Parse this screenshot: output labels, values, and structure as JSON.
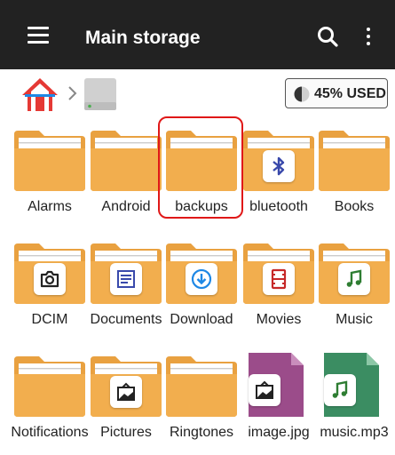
{
  "appbar": {
    "title": "Main storage",
    "icons": [
      "menu-icon",
      "search-icon",
      "more-vertical-icon"
    ]
  },
  "breadcrumb": {
    "icons": [
      "home-icon",
      "chevron-right-icon",
      "drive-icon"
    ],
    "usage_label": "45% USED",
    "usage_fraction": 0.45
  },
  "colors": {
    "appbar_bg": "#222222",
    "folder": "#F2AE4E",
    "folder_tab": "#E9A140",
    "selection": "#e01818",
    "image_file": "#9B4C8A",
    "audio_file": "#3B8D62"
  },
  "items": [
    {
      "label": "Alarms",
      "type": "folder"
    },
    {
      "label": "Android",
      "type": "folder"
    },
    {
      "label": "backups",
      "type": "folder",
      "selected": true
    },
    {
      "label": "bluetooth",
      "type": "folder",
      "badge": "bluetooth-icon"
    },
    {
      "label": "Books",
      "type": "folder"
    },
    {
      "label": "DCIM",
      "type": "folder",
      "badge": "camera-icon"
    },
    {
      "label": "Documents",
      "type": "folder",
      "badge": "document-icon"
    },
    {
      "label": "Download",
      "type": "folder",
      "badge": "download-icon"
    },
    {
      "label": "Movies",
      "type": "folder",
      "badge": "film-icon"
    },
    {
      "label": "Music",
      "type": "folder",
      "badge": "music-note-icon"
    },
    {
      "label": "Notifications",
      "type": "folder"
    },
    {
      "label": "Pictures",
      "type": "folder",
      "badge": "image-icon"
    },
    {
      "label": "Ringtones",
      "type": "folder"
    },
    {
      "label": "image.jpg",
      "type": "file",
      "badge": "image-icon"
    },
    {
      "label": "music.mp3",
      "type": "file",
      "badge": "music-note-icon"
    }
  ]
}
